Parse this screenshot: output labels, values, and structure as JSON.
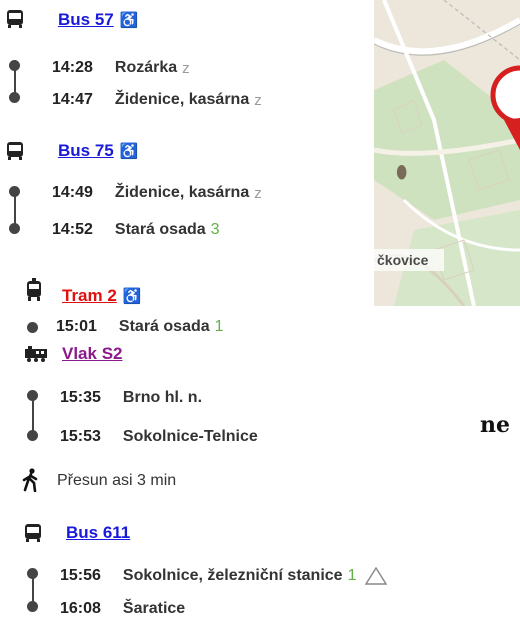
{
  "legs": [
    {
      "line": "Bus 57",
      "line_color": "#1a1adb",
      "icon": "bus-icon",
      "wheelchair": "♿",
      "stops": [
        {
          "time": "14:28",
          "name": "Rozárka",
          "suffix": "z",
          "suffix_type": "request"
        },
        {
          "time": "14:47",
          "name": "Židenice, kasárna",
          "suffix": "z",
          "suffix_type": "request"
        }
      ]
    },
    {
      "line": "Bus 75",
      "line_color": "#1a1adb",
      "icon": "bus-icon",
      "wheelchair": "♿",
      "stops": [
        {
          "time": "14:49",
          "name": "Židenice, kasárna",
          "suffix": "z",
          "suffix_type": "request"
        },
        {
          "time": "14:52",
          "name": "Stará osada",
          "suffix": "3",
          "suffix_type": "platform"
        }
      ]
    },
    {
      "line": "Tram 2",
      "line_color": "#e01010",
      "icon": "tram-icon",
      "wheelchair": "♿",
      "stops": [
        {
          "time": "15:01",
          "name": "Stará osada",
          "suffix": "1",
          "suffix_type": "platform"
        }
      ]
    },
    {
      "line": "Vlak S2",
      "line_color": "#8b1a8b",
      "icon": "train-icon",
      "wheelchair": "",
      "stops": [
        {
          "time": "15:35",
          "name": "Brno hl. n.",
          "suffix": "",
          "suffix_type": ""
        },
        {
          "time": "15:53",
          "name": "Sokolnice-Telnice",
          "suffix": "",
          "suffix_type": ""
        }
      ]
    },
    {
      "line": "Bus 611",
      "line_color": "#1a1adb",
      "icon": "bus-icon",
      "wheelchair": "",
      "stops": [
        {
          "time": "15:56",
          "name": "Sokolnice, železniční stanice",
          "suffix": "1",
          "suffix_type": "platform"
        },
        {
          "time": "16:08",
          "name": "Šaratice",
          "suffix": "",
          "suffix_type": ""
        }
      ]
    }
  ],
  "transfer": {
    "text": "Přesun asi 3 min",
    "icon": "walking-person-icon"
  },
  "map": {
    "label": "čkovice"
  },
  "cut_text": "ne",
  "colors": {
    "platform": "#64b046",
    "request": "#9a9a9a",
    "pin": "#d62020"
  }
}
